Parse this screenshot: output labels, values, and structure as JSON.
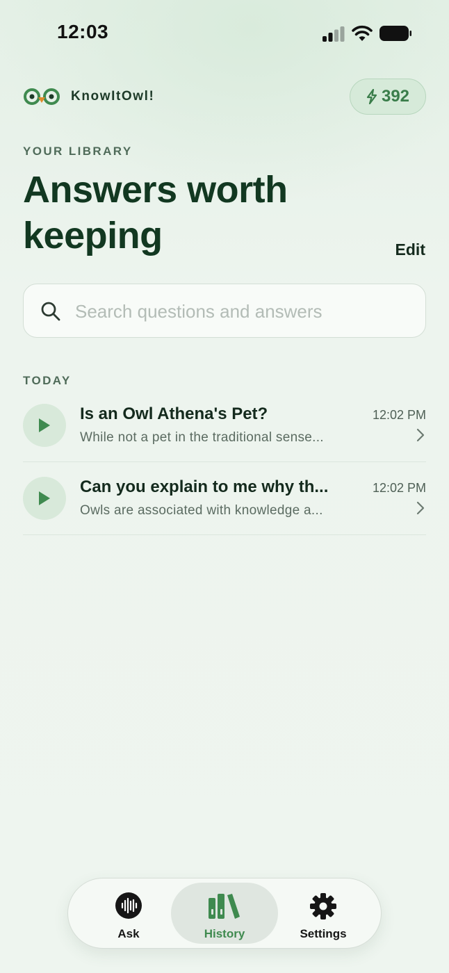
{
  "status_bar": {
    "time": "12:03"
  },
  "header": {
    "app_name": "KnowItOwl!",
    "credits": "392",
    "credits_icon": "bolt-icon"
  },
  "library": {
    "eyebrow": "YOUR LIBRARY",
    "title": "Answers worth keeping",
    "edit_label": "Edit"
  },
  "search": {
    "placeholder": "Search questions and answers",
    "value": ""
  },
  "sections": [
    {
      "label": "TODAY",
      "items": [
        {
          "title": "Is an Owl Athena's Pet?",
          "subtitle": "While not a pet in the traditional sense...",
          "time": "12:02 PM"
        },
        {
          "title": "Can you explain to me why th...",
          "subtitle": "Owls are associated with knowledge a...",
          "time": "12:02 PM"
        }
      ]
    }
  ],
  "tabbar": {
    "tabs": [
      {
        "label": "Ask",
        "icon": "waveform-icon",
        "active": false
      },
      {
        "label": "History",
        "icon": "books-icon",
        "active": true
      },
      {
        "label": "Settings",
        "icon": "gear-icon",
        "active": false
      }
    ]
  },
  "colors": {
    "accent": "#3f8a4f",
    "title": "#123821",
    "background": "#eef5ef"
  }
}
